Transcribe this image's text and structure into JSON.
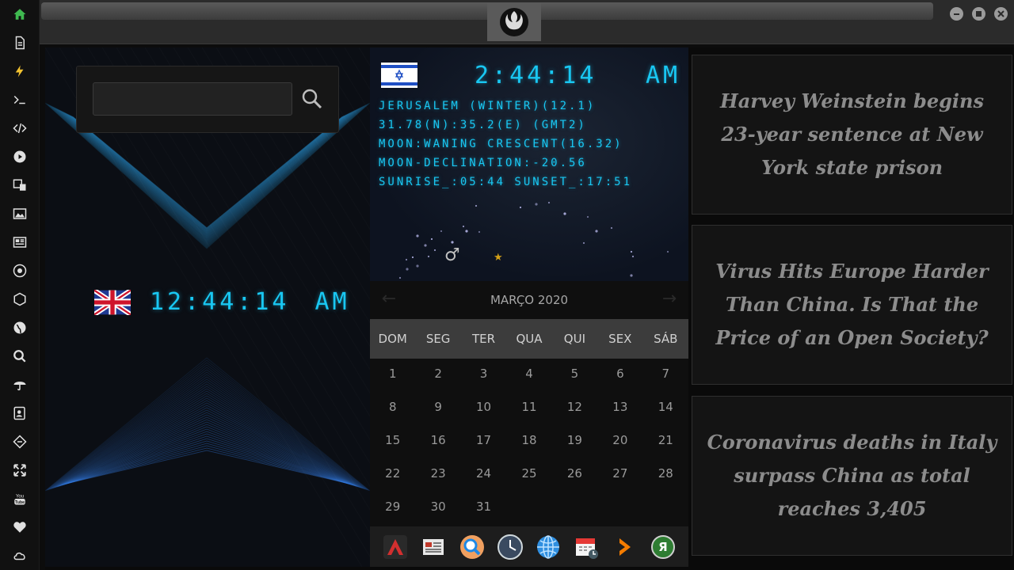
{
  "sidebar": {
    "items": [
      {
        "icon": "home-icon",
        "active": true
      },
      {
        "icon": "document-icon"
      },
      {
        "icon": "lightning-icon"
      },
      {
        "icon": "terminal-icon"
      },
      {
        "icon": "code-icon"
      },
      {
        "icon": "play-icon"
      },
      {
        "icon": "translate-icon"
      },
      {
        "icon": "image-icon"
      },
      {
        "icon": "news-icon"
      },
      {
        "icon": "aperture-icon"
      },
      {
        "icon": "hexagon-icon"
      },
      {
        "icon": "globe-icon"
      },
      {
        "icon": "search-icon"
      },
      {
        "icon": "umbrella-icon"
      },
      {
        "icon": "contacts-icon"
      },
      {
        "icon": "tag-icon"
      },
      {
        "icon": "expand-icon"
      },
      {
        "icon": "youtube-icon"
      },
      {
        "icon": "heart-icon"
      },
      {
        "icon": "cloud-icon"
      }
    ]
  },
  "search": {
    "value": "",
    "placeholder": ""
  },
  "uk_clock": {
    "time": "12:44:14",
    "ampm": "AM"
  },
  "israel_clock": {
    "time": "2:44:14",
    "ampm": "AM",
    "lines": [
      "JERUSALEM (WINTER)(12.1)",
      "31.78(N):35.2(E) (GMT2)",
      "MOON:WANING CRESCENT(16.32)",
      "MOON-DECLINATION:-20.56",
      "SUNRISE_:05:44 SUNSET_:17:51"
    ],
    "mars_symbol": "♂",
    "star_symbol": "★"
  },
  "calendar": {
    "title": "MARÇO 2020",
    "prev": "←",
    "next": "→",
    "weekdays": [
      "DOM",
      "SEG",
      "TER",
      "QUA",
      "QUI",
      "SEX",
      "SÁB"
    ],
    "days": [
      "1",
      "2",
      "3",
      "4",
      "5",
      "6",
      "7",
      "8",
      "9",
      "10",
      "11",
      "12",
      "13",
      "14",
      "15",
      "16",
      "17",
      "18",
      "19",
      "20",
      "21",
      "22",
      "23",
      "24",
      "25",
      "26",
      "27",
      "28",
      "29",
      "30",
      "31"
    ]
  },
  "dock": [
    {
      "icon": "app-launcher-icon"
    },
    {
      "icon": "news-reader-icon"
    },
    {
      "icon": "search-app-icon"
    },
    {
      "icon": "clock-app-icon"
    },
    {
      "icon": "web-browser-icon"
    },
    {
      "icon": "calendar-app-icon"
    },
    {
      "icon": "arrow-app-icon"
    },
    {
      "icon": "yandex-icon",
      "label": "Я"
    }
  ],
  "news": [
    {
      "headline": "Harvey Weinstein begins 23-year sentence at New York state prison"
    },
    {
      "headline": "Virus Hits Europe Harder Than China. Is That the Price of an Open Society?"
    },
    {
      "headline": "Coronavirus deaths in Italy surpass China as total reaches 3,405"
    }
  ],
  "colors": {
    "digital": "#19c7f2",
    "sidebar_active": "#3fb950",
    "sidebar_icon": "#e0e0e0",
    "news_text": "#8c8c8c"
  }
}
